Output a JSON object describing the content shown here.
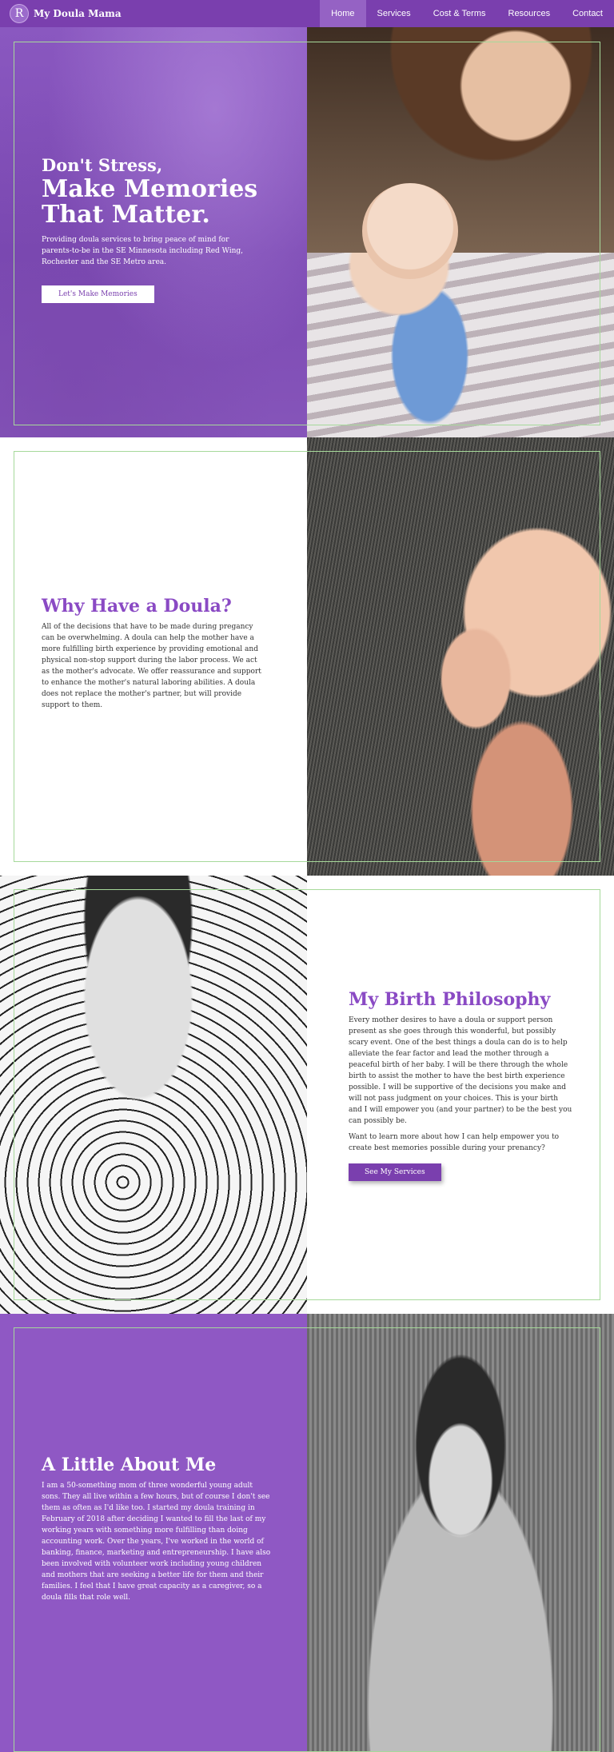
{
  "nav": {
    "logo_letter": "R",
    "brand": "My Doula Mama",
    "items": [
      {
        "label": "Home",
        "active": true
      },
      {
        "label": "Services",
        "active": false
      },
      {
        "label": "Cost & Terms",
        "active": false
      },
      {
        "label": "Resources",
        "active": false
      },
      {
        "label": "Contact",
        "active": false
      }
    ]
  },
  "hero": {
    "small_title": "Don't Stress,",
    "title_line1": "Make Memories",
    "title_line2": "That Matter.",
    "description": "Providing doula services to bring peace of mind for parents-to-be in the SE Minnesota including Red Wing, Rochester and the SE Metro area.",
    "button": "Let's Make Memories"
  },
  "why": {
    "title": "Why Have a Doula?",
    "body": "All of the decisions that have to be made during pregancy can be overwhelming. A doula can help the mother have a more fulfilling birth experience by providing emotional and physical non-stop support during the labor process. We act as the mother's advocate. We offer reassurance and support to enhance the mother's natural laboring abilities. A doula does not replace the mother's partner, but will provide support to them."
  },
  "philosophy": {
    "title": "My Birth Philosophy",
    "body": "Every mother desires to have a doula or support person present as she goes through this wonderful, but possibly scary event. One of the best things a doula can do is to help alleviate the fear factor and lead the mother through a peaceful birth of her baby. I will be there through the whole birth to assist the mother to have the best birth experience possible. I will be supportive of the decisions you make and will not pass judgment on your choices. This is your birth and I will empower you (and your partner) to be the best you can possibly be.",
    "body2": "Want to learn more about how I can help empower you to create best memories possible during your prenancy?",
    "button": "See My Services"
  },
  "about": {
    "title": "A Little About Me",
    "body": "I am a 50-something mom of three wonderful young adult sons. They all live within a few hours, but of course I don't see them as often as I'd like too. I started my doula training in February of 2018 after deciding I wanted to fill the last of my working years with something more fulfilling than doing accounting work. Over the years, I've worked in the world of banking, finance, marketing and entrepreneurship. I have also been involved with volunteer work including young children and mothers that are seeking a better life for them and their families. I feel that I have great capacity as a caregiver, so a doula fills that role well."
  },
  "colors": {
    "accent": "#7a3fae",
    "heading_purple": "#8a4ac4",
    "about_bg": "#8f58c4",
    "frame": "#a6d99a"
  }
}
